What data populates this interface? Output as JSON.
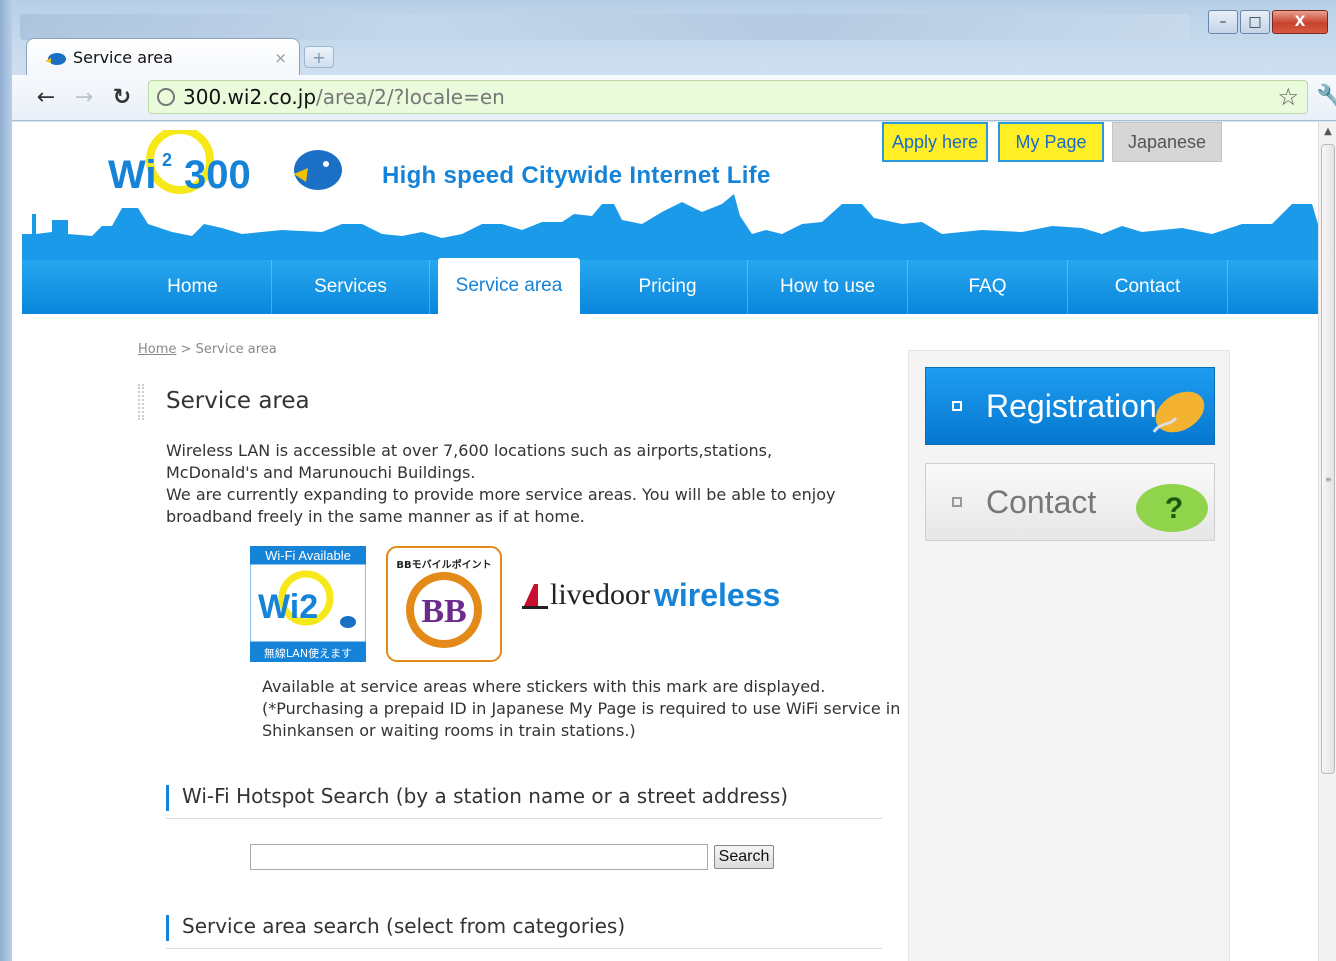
{
  "browser": {
    "tab_title": "Service area",
    "url_host": "300.wi2.co.jp",
    "url_path": "/area/2/?locale=en",
    "window_buttons": {
      "minimize": "–",
      "maximize": "□",
      "close": "X"
    }
  },
  "header": {
    "logo_text": "Wi2 300",
    "tagline": "High speed Citywide Internet Life",
    "top_buttons": {
      "apply": "Apply here",
      "mypage": "My Page",
      "japanese": "Japanese"
    }
  },
  "nav": {
    "items": [
      "Home",
      "Services",
      "Service area",
      "Pricing",
      "How to use",
      "FAQ",
      "Contact"
    ],
    "active": "Service area"
  },
  "breadcrumb": {
    "home": "Home",
    "separator": " > ",
    "current": "Service area"
  },
  "main": {
    "title": "Service area",
    "intro_1": "Wireless LAN is accessible at over 7,600 locations such as airports,stations, McDonald's and Marunouchi Buildings.",
    "intro_2": "We are currently expanding to provide more service areas. You will be able to enjoy broadband freely in the same manner as if at home.",
    "stickers": {
      "wifi_available": "Wi-Fi Available",
      "wifi_logo": "Wi2",
      "wifi_bottom": "無線LAN使えます",
      "bb_top": "BBモバイルポイント",
      "bb_logo": "BB",
      "livedoor": "livedoor",
      "wireless": "wireless"
    },
    "available_text": "Available at service areas where stickers with this mark are displayed. (*Purchasing a prepaid ID in Japanese My Page is required to use WiFi service in Shinkansen or waiting rooms in train stations.)",
    "hotspot_heading": "Wi-Fi Hotspot Search (by a station name or a street address)",
    "search_value": "",
    "search_button": "Search",
    "category_heading": "Service area search (select from categories)"
  },
  "sidebar": {
    "registration": "Registration",
    "contact": "Contact",
    "question_mark": "?"
  },
  "colors": {
    "brand_blue": "#1583d8",
    "nav_blue": "#0a86dc",
    "yellow": "#ffef24"
  }
}
